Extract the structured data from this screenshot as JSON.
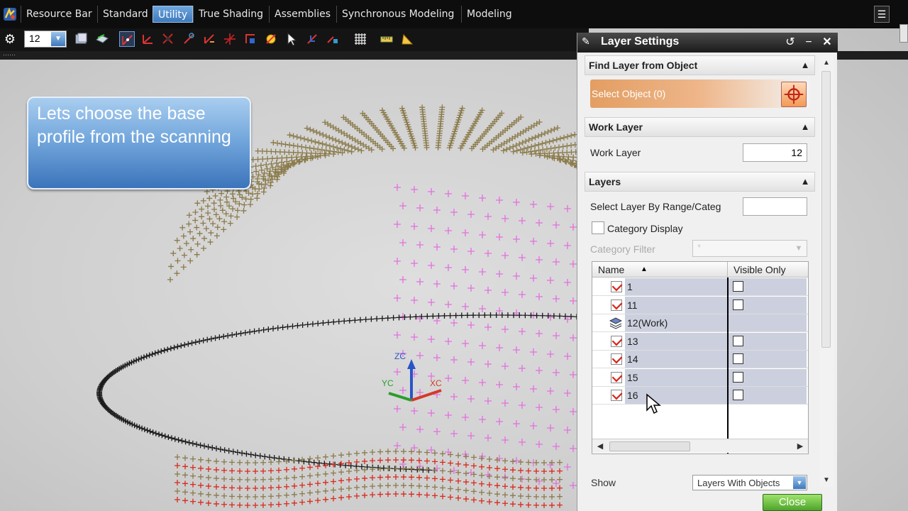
{
  "menubar": {
    "tabs": [
      "Resource Bar",
      "Standard",
      "Utility",
      "True Shading",
      "Assemblies",
      "Synchronous Modeling",
      "Modeling"
    ],
    "active_tab": "Utility"
  },
  "toolbar": {
    "layer_value": "12"
  },
  "callout": {
    "text": "Lets choose the base profile from the scanning"
  },
  "triad": {
    "zc": "ZC",
    "yc": "YC",
    "xc": "XC"
  },
  "dialog": {
    "title": "Layer Settings",
    "find_layer": {
      "header": "Find Layer from Object",
      "select_object_label": "Select Object (0)"
    },
    "work_layer": {
      "header": "Work Layer",
      "label": "Work Layer",
      "value": "12"
    },
    "layers": {
      "header": "Layers",
      "select_range_label": "Select Layer By Range/Categ",
      "select_range_value": "",
      "category_display_label": "Category Display",
      "category_filter_label": "Category Filter",
      "category_filter_value": "*",
      "table": {
        "col_name": "Name",
        "col_visible": "Visible Only",
        "rows": [
          {
            "name": "1",
            "checked": true,
            "work": false
          },
          {
            "name": "11",
            "checked": true,
            "work": false
          },
          {
            "name": "12(Work)",
            "checked": false,
            "work": true
          },
          {
            "name": "13",
            "checked": true,
            "work": false
          },
          {
            "name": "14",
            "checked": true,
            "work": false
          },
          {
            "name": "15",
            "checked": true,
            "work": false
          },
          {
            "name": "16",
            "checked": true,
            "work": false
          }
        ]
      },
      "show_label": "Show",
      "show_value": "Layers With Objects"
    },
    "close_label": "Close"
  },
  "colors": {
    "accent": "#3d79bd",
    "point_olive": "#8a7a4a",
    "point_magenta": "#e36fe0",
    "point_red": "#d82a1a",
    "point_dark": "#1a1a1a"
  }
}
